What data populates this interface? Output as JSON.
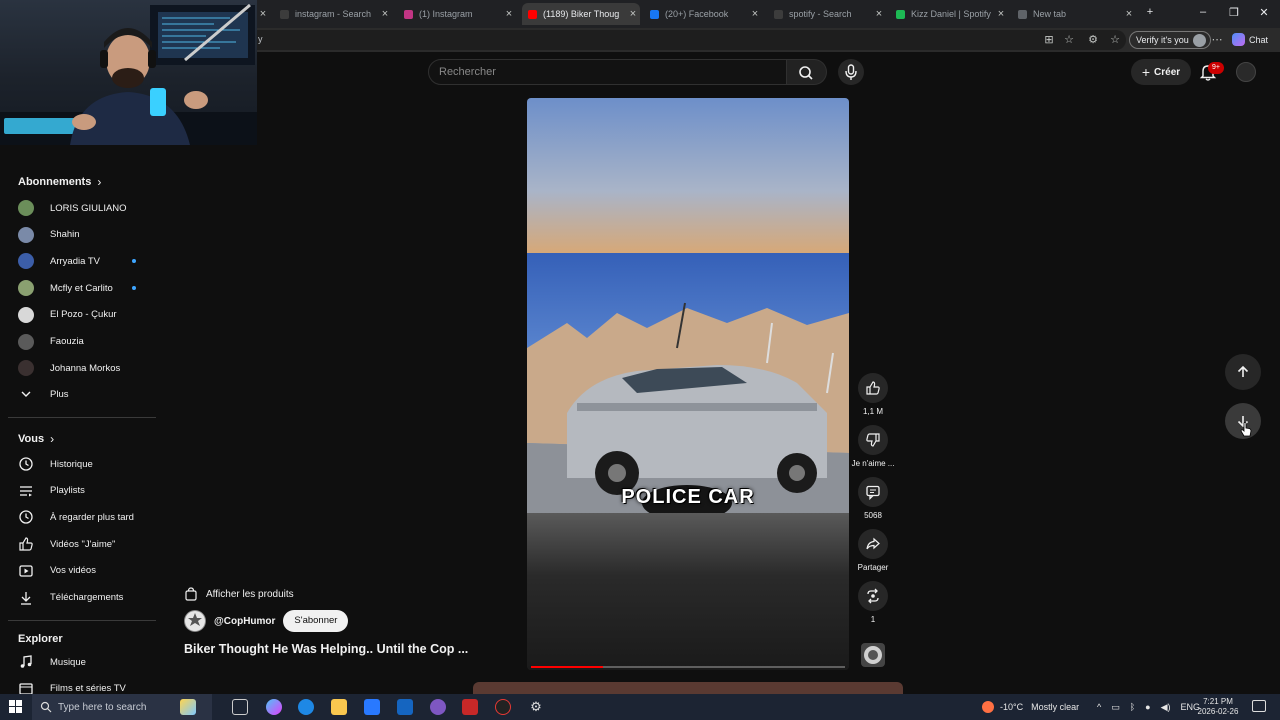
{
  "browser": {
    "tabs": [
      {
        "title": "",
        "active": false,
        "favicon_color": "#5f6368"
      },
      {
        "title": "instagram - Search",
        "active": false,
        "favicon_color": "#3c3c3c"
      },
      {
        "title": "(1) Instagram",
        "active": false,
        "favicon_color": "#c13584"
      },
      {
        "title": "(1189) Biker Thoug",
        "active": true,
        "favicon_color": "#ff0000"
      },
      {
        "title": "(20+) Facebook",
        "active": false,
        "favicon_color": "#1877f2"
      },
      {
        "title": "spotify - Search",
        "active": false,
        "favicon_color": "#3c3c3c"
      },
      {
        "title": "Kizz Daniel | Spotify",
        "active": false,
        "favicon_color": "#1db954"
      },
      {
        "title": "New tab",
        "active": false,
        "favicon_color": "#5f6368"
      }
    ],
    "address_fragment": "y",
    "verify_label": "Verify it's you",
    "chat_label": "Chat"
  },
  "header": {
    "search_placeholder": "Rechercher",
    "create_label": "Créer",
    "notif_badge": "9+"
  },
  "sidebar": {
    "subscriptions_title": "Abonnements",
    "subscriptions": [
      {
        "label": "LORIS GIULIANO",
        "avatar_color": "#6b8e5a",
        "new": false
      },
      {
        "label": "Shahin",
        "avatar_color": "#7a8aa8",
        "new": false
      },
      {
        "label": "Arryadia TV",
        "avatar_color": "#3c5ea8",
        "new": true
      },
      {
        "label": "Mcfly et Carlito",
        "avatar_color": "#8aa070",
        "new": true
      },
      {
        "label": "El Pozo - Çukur",
        "avatar_color": "#d8d8d8",
        "new": false
      },
      {
        "label": "Faouzia",
        "avatar_color": "#5a5a5a",
        "new": false
      },
      {
        "label": "Johanna Morkos",
        "avatar_color": "#3a3030",
        "new": false
      }
    ],
    "more_label": "Plus",
    "you_title": "Vous",
    "you_items": [
      {
        "label": "Historique",
        "icon": "history-icon"
      },
      {
        "label": "Playlists",
        "icon": "playlists-icon"
      },
      {
        "label": "À regarder plus tard",
        "icon": "watch-later-icon"
      },
      {
        "label": "Vidéos \"J'aime\"",
        "icon": "thumb-up-icon"
      },
      {
        "label": "Vos vidéos",
        "icon": "your-videos-icon"
      },
      {
        "label": "Téléchargements",
        "icon": "download-icon"
      }
    ],
    "explore_title": "Explorer",
    "explore_items": [
      {
        "label": "Musique",
        "icon": "music-icon"
      },
      {
        "label": "Films et séries TV",
        "icon": "film-icon"
      }
    ]
  },
  "short": {
    "caption": "POLICE CAR",
    "progress": 0.23,
    "actions": [
      {
        "icon": "like-icon",
        "label": "1,1 M"
      },
      {
        "icon": "dislike-icon",
        "label": "Je n'aime ..."
      },
      {
        "icon": "comment-icon",
        "label": "5068"
      },
      {
        "icon": "share-icon",
        "label": "Partager"
      },
      {
        "icon": "remix-icon",
        "label": "1"
      }
    ],
    "products_label": "Afficher les produits",
    "channel": "@CopHumor",
    "subscribe_label": "S'abonner",
    "title": "Biker Thought He Was Helping.. Until the Cop ..."
  },
  "taskbar": {
    "search_placeholder": "Type here to search",
    "weather": "-10°C",
    "weather_text": "Mostly clear",
    "language": "ENG",
    "time": "7:21 PM",
    "date": "2026-02-26"
  }
}
